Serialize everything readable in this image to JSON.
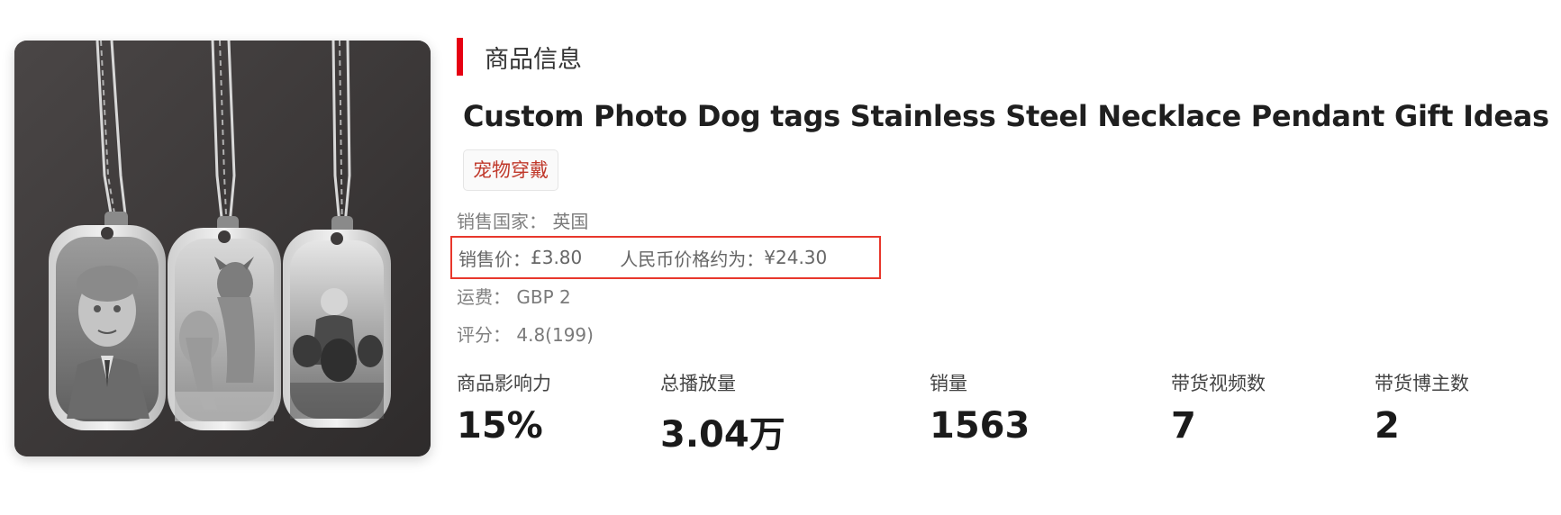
{
  "section": {
    "title": "商品信息"
  },
  "product": {
    "title": "Custom Photo Dog tags Stainless Steel Necklace Pendant Gift Ideas",
    "category_tag": "宠物穿戴",
    "image_description_icon": "product-photo-icon"
  },
  "info": {
    "country_label": "销售国家：",
    "country_value": "英国",
    "price_label": "销售价：",
    "price_value": "£3.80",
    "rmb_label": "人民币价格约为：",
    "rmb_value": "¥24.30",
    "shipping_label": "运费：",
    "shipping_value": "GBP 2",
    "rating_label": "评分：",
    "rating_value": "4.8(199)"
  },
  "stats": [
    {
      "label": "商品影响力",
      "value": "15%"
    },
    {
      "label": "总播放量",
      "value": "3.04万"
    },
    {
      "label": "销量",
      "value": "1563"
    },
    {
      "label": "带货视频数",
      "value": "7"
    },
    {
      "label": "带货博主数",
      "value": "2"
    }
  ],
  "colors": {
    "accent": "#e60012",
    "highlight_border": "#e8372c",
    "tag_text": "#c0392b"
  }
}
